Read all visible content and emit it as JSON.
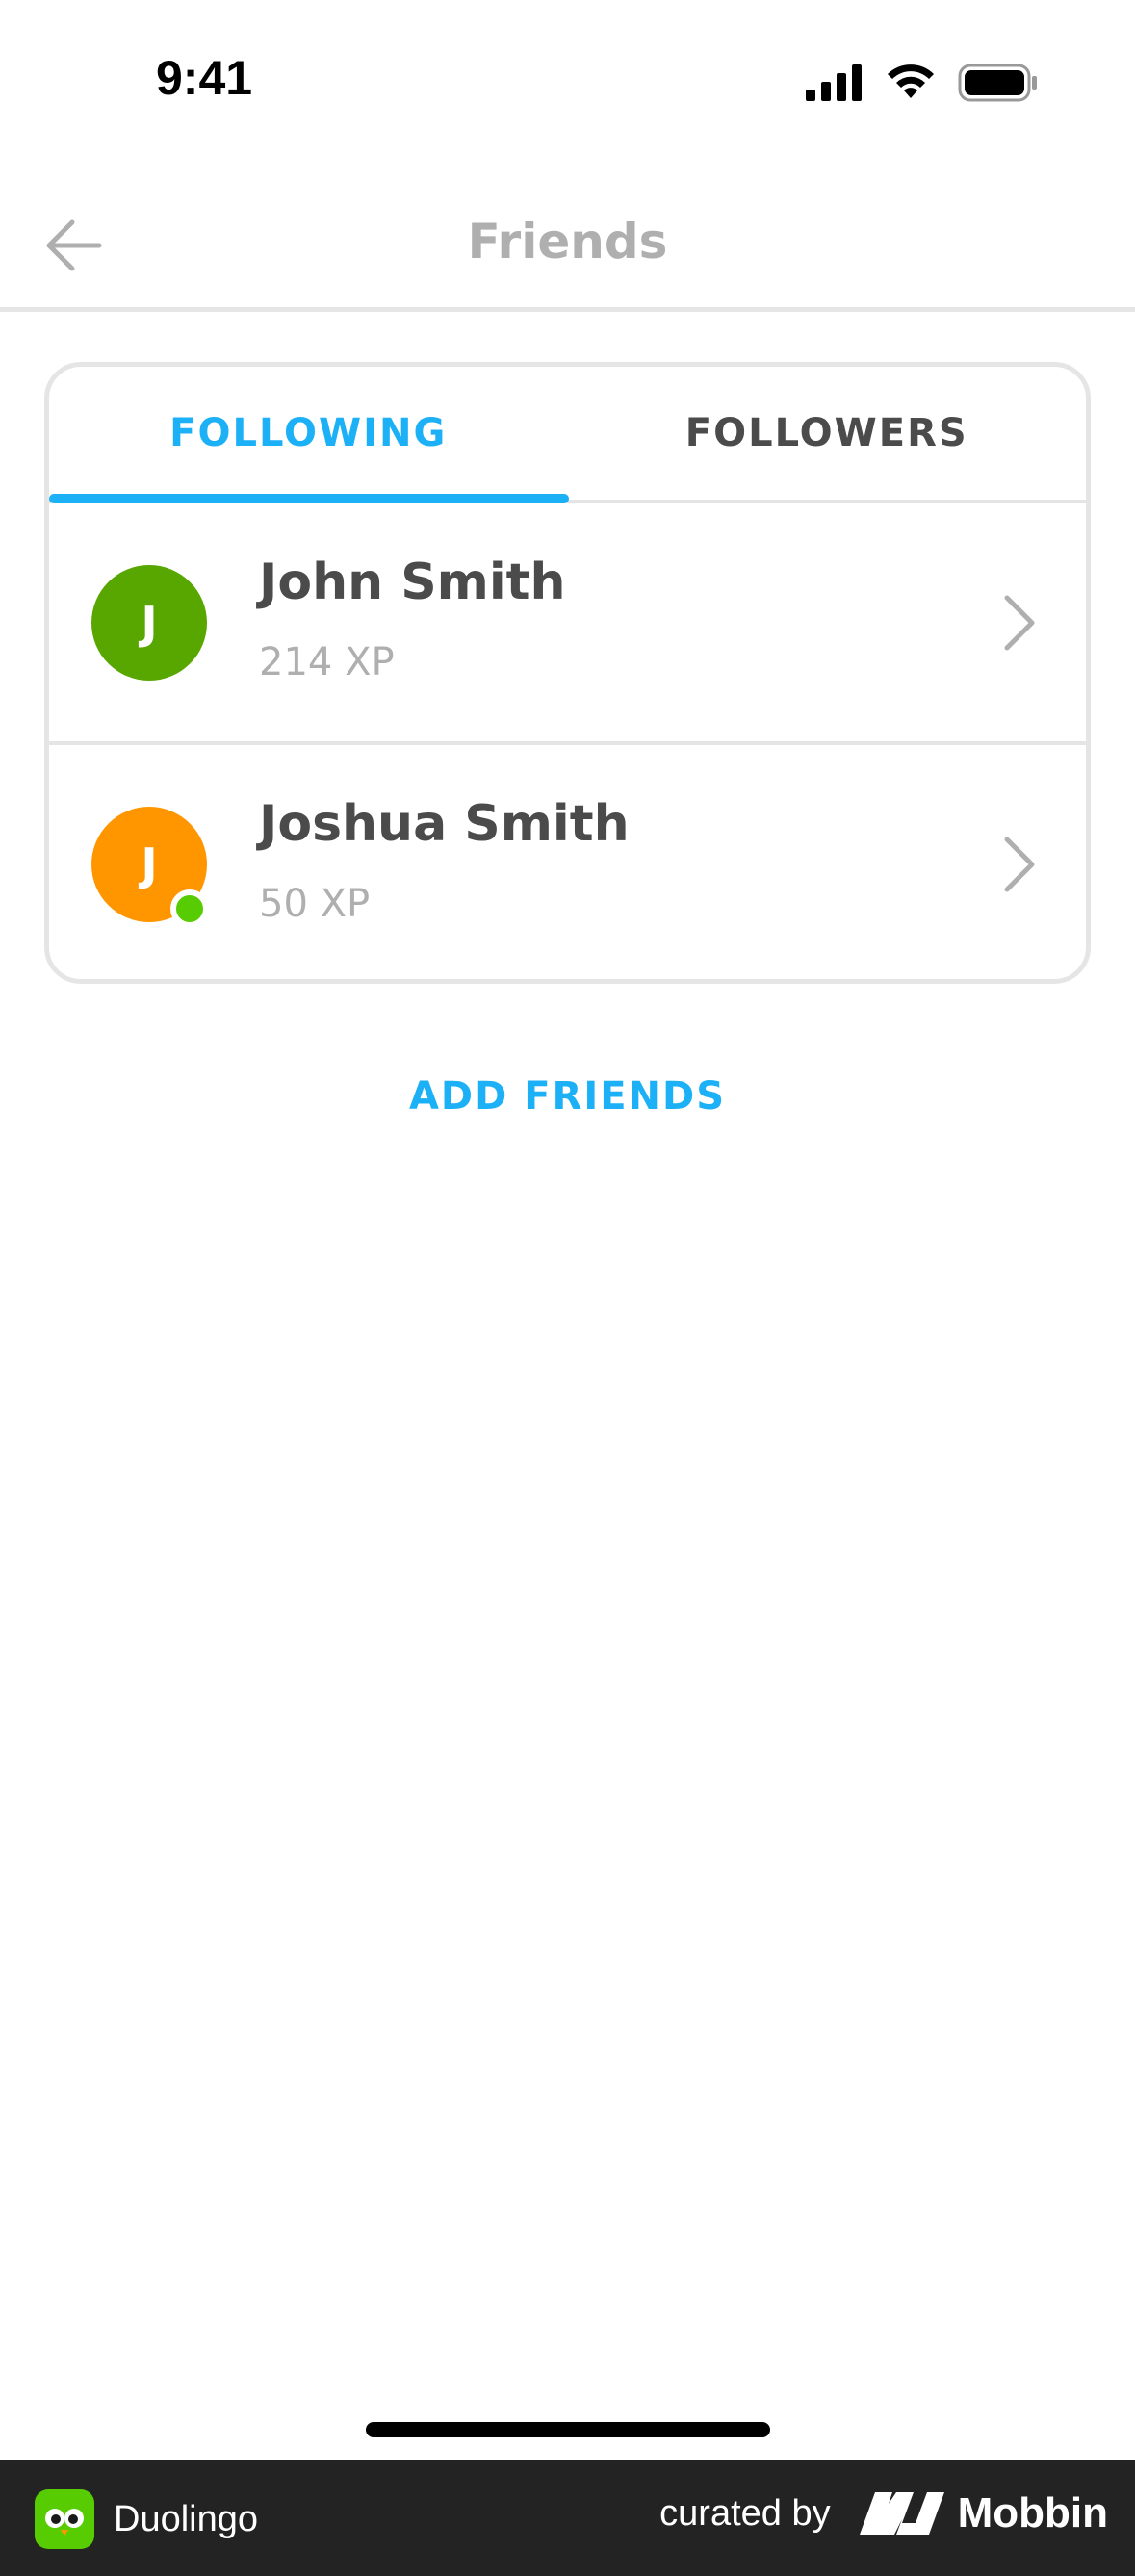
{
  "status_bar": {
    "time": "9:41"
  },
  "header": {
    "title": "Friends"
  },
  "tabs": [
    {
      "label": "FOLLOWING",
      "active": true
    },
    {
      "label": "FOLLOWERS",
      "active": false
    }
  ],
  "friends": [
    {
      "initial": "J",
      "name": "John Smith",
      "xp": "214 XP",
      "avatar_color": "#58a700",
      "online": false
    },
    {
      "initial": "J",
      "name": "Joshua Smith",
      "xp": "50 XP",
      "avatar_color": "#ff9600",
      "online": true
    }
  ],
  "add_friends_label": "ADD FRIENDS",
  "footer": {
    "app_name": "Duolingo",
    "curated_label": "curated by",
    "brand": "Mobbin"
  },
  "colors": {
    "accent": "#1cb0f6",
    "online": "#58cc02",
    "divider": "#e5e5e5"
  }
}
